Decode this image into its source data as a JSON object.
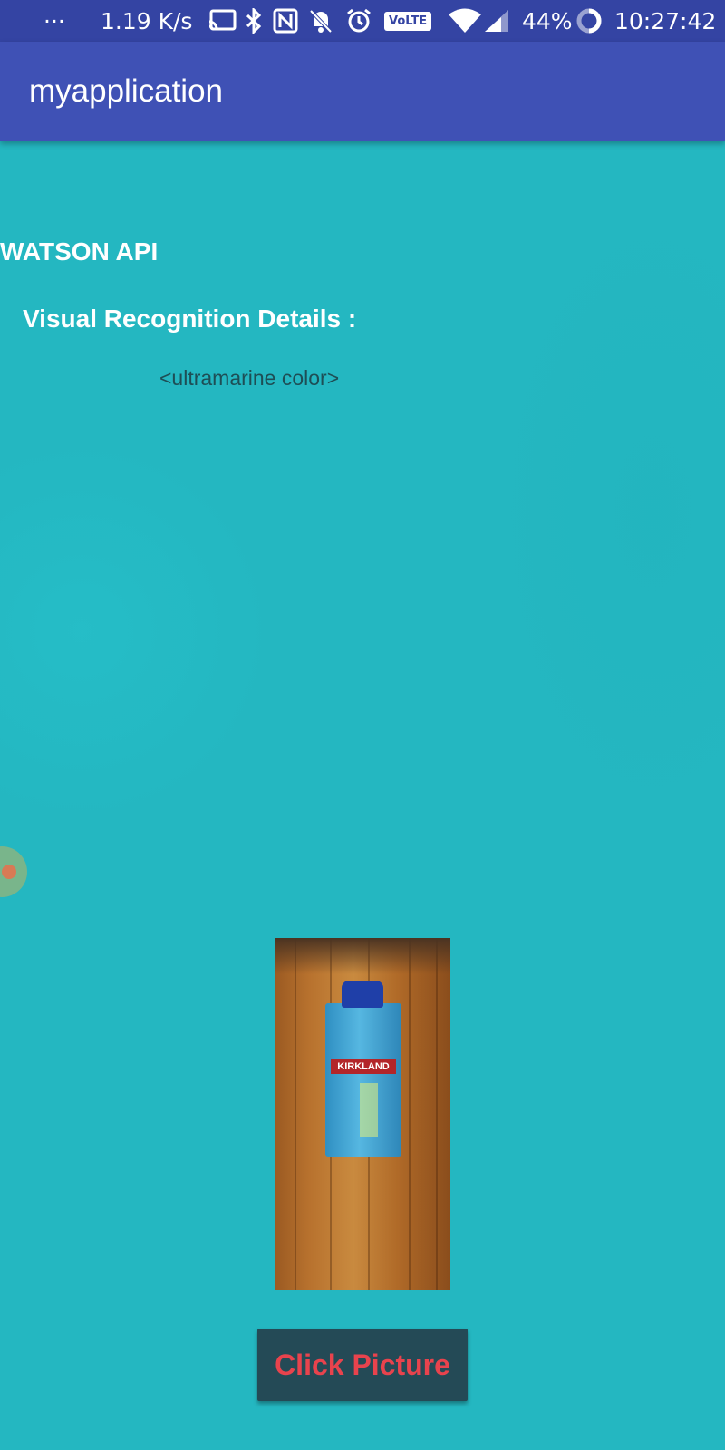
{
  "status_bar": {
    "menu_glyph": "···",
    "net_speed": "1.19 K/s",
    "volte_badge": "VoLTE",
    "battery": "44%",
    "time": "10:27:42",
    "icons": [
      "cast-icon",
      "bluetooth-icon",
      "nfc-icon",
      "mute-icon",
      "alarm-icon",
      "volte-icon",
      "wifi-icon",
      "signal-icon",
      "battery-saver-icon"
    ]
  },
  "app_bar": {
    "title": "myapplication"
  },
  "main": {
    "heading": "WATSON API",
    "subheading": "Visual Recognition Details :",
    "result": "<ultramarine color>",
    "photo": {
      "brand_text": "KIRKLAND",
      "description": "photo of a coconut water carton on a wooden floor"
    },
    "button_label": "Click Picture"
  },
  "colors": {
    "status_bar": "#3444a3",
    "app_bar": "#3f51b5",
    "background": "#24b7c1",
    "button_bg": "#244a56",
    "button_text": "#e8434d",
    "result_text": "#1e4e55"
  }
}
